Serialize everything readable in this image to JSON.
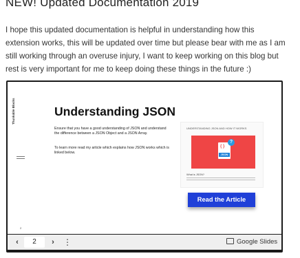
{
  "heading": "NEW! Updated Documentation 2019",
  "intro": "I hope this updated documentation is helpful in understanding how this extension works, this will be updated over time but please bear with me as I am still working through an overuse injury, I want to keep working on this blog but rest is very important for me to keep doing these things in the future :)",
  "slide": {
    "brand": "Thunkable Blocks",
    "title": "Understanding JSON",
    "para1": "Ensure that you have a good understanding of JSON and understand the difference between a JSON Object and a JSON Array.",
    "para2": "To learn more read my article which explains how JSON works which is linked below.",
    "thumb_title": "UNDERSTANDING JSON AND HOW IT WORKS",
    "thumb_braces": "{ }",
    "thumb_json": "JSON",
    "thumb_q": "?",
    "thumb_sub": "What is JSON?",
    "button": "Read the Article",
    "page_number_small": "2"
  },
  "toolbar": {
    "prev": "‹",
    "page": "2",
    "next": "›",
    "more": "⋮",
    "google_slides": "Google Slides"
  },
  "colors": {
    "button_bg": "#2040d8",
    "thumb_bg": "#ef4545",
    "json_badge": "#1e80d8"
  }
}
